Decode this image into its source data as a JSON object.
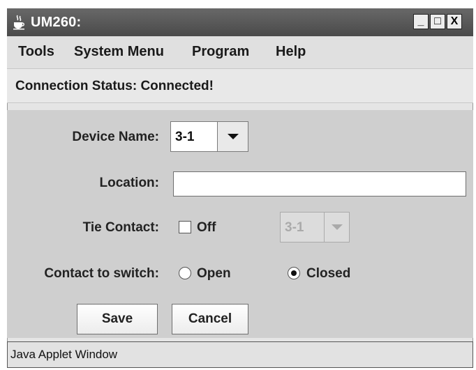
{
  "window": {
    "title": "UM260:",
    "icon": "java-cup-icon",
    "controls": {
      "minimize": "_",
      "maximize": "□",
      "close": "X"
    }
  },
  "menu": [
    "Tools",
    "System Menu",
    "Program",
    "Help"
  ],
  "status": "Connection Status: Connected!",
  "form": {
    "device_name": {
      "label": "Device Name:",
      "value": "3-1"
    },
    "location": {
      "label": "Location:",
      "value": ""
    },
    "tie_contact": {
      "label": "Tie Contact:",
      "checkbox_label": "Off",
      "checked": false,
      "select_value": "3-1",
      "select_enabled": false
    },
    "contact_to_switch": {
      "label": "Contact to switch:",
      "options": [
        "Open",
        "Closed"
      ],
      "selected": "Closed"
    }
  },
  "buttons": {
    "save": "Save",
    "cancel": "Cancel"
  },
  "footer": "Java Applet Window"
}
